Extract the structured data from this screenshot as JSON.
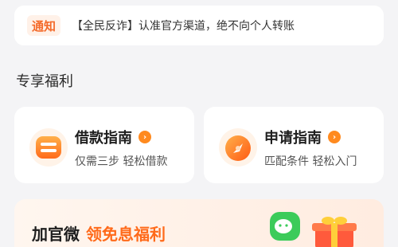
{
  "notice": {
    "tag": "通知",
    "text": "【全民反诈】认准官方渠道，绝不向个人转账"
  },
  "section": {
    "title": "专享福利"
  },
  "cards": [
    {
      "title": "借款指南",
      "subtitle": "仅需三步 轻松借款",
      "icon": "loan-guide-icon"
    },
    {
      "title": "申请指南",
      "subtitle": "匹配条件 轻松入门",
      "icon": "apply-guide-icon"
    }
  ],
  "promo": {
    "text_a": "加官微",
    "text_b": "领免息福利"
  },
  "colors": {
    "accent": "#ff8a1f",
    "promo_accent": "#ff6a1a",
    "tag_bg": "#fff1e8"
  }
}
